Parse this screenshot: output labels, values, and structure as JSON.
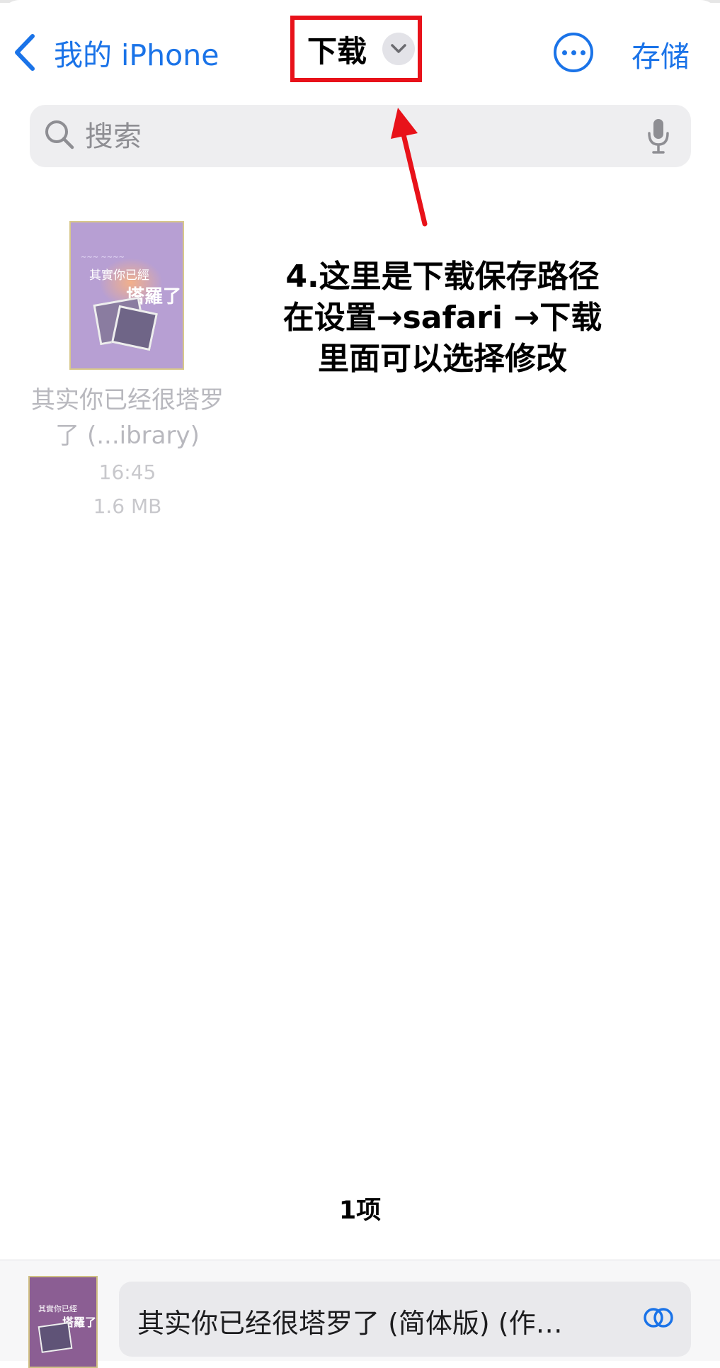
{
  "nav": {
    "back_label": "我的 iPhone",
    "title": "下载",
    "save_label": "存储"
  },
  "search": {
    "placeholder": "搜索"
  },
  "file": {
    "name": "其实你已经很塔罗了 (...ibrary)",
    "time": "16:45",
    "size": "1.6 MB",
    "thumb_title_1": "其實你已經",
    "thumb_title_2": "塔羅了"
  },
  "annotation": {
    "line1": "4.这里是下载保存路径",
    "line2": "在设置→safari →下载",
    "line3": "里面可以选择修改",
    "color": "#e8121a"
  },
  "footer": {
    "count": "1项"
  },
  "bottom_bar": {
    "filename": "其实你已经很塔罗了 (简体版) (作…"
  },
  "colors": {
    "accent": "#1a73e8",
    "highlight": "#e8121a"
  }
}
